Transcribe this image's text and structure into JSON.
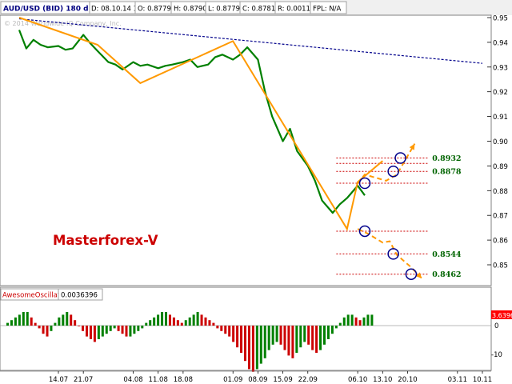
{
  "header": {
    "symbol": "AUD/USD (BID) 180 d 4h",
    "date": "D: 08.10.14 16:00",
    "open": "O: 0.8779",
    "high": "H: 0.8790",
    "low": "L: 0.8779",
    "close": "C: 0.8781",
    "range": "R: 0.0011",
    "fpl": "FPL: N/A",
    "copyright": "© 2014 Worldwide-IQ Company, Inc."
  },
  "brand_label": "Masterforex-V",
  "oscillator": {
    "name": "AwesomeOscillator",
    "value": "0.0036396",
    "current_tag": "3.6396",
    "y_ticks": [
      "0",
      "-10"
    ]
  },
  "chart_data": [
    {
      "type": "line",
      "title": "AUD/USD (BID) 180 d 4h",
      "x_tick_labels": [
        "14.07",
        "21.07",
        "04.08",
        "11.08",
        "18.08",
        "01.09",
        "08.09",
        "15.09",
        "22.09",
        "06.10",
        "13.10",
        "20.10",
        "03.11",
        "10.11"
      ],
      "y_tick_labels": [
        "0.95",
        "0.94",
        "0.93",
        "0.92",
        "0.91",
        "0.90",
        "0.89",
        "0.88",
        "0.87",
        "0.86",
        "0.85"
      ],
      "ylim": [
        0.842,
        0.953
      ],
      "grid": false,
      "series": [
        {
          "x": [
            "03.07",
            "05.07",
            "07.07",
            "09.07",
            "11.07",
            "14.07",
            "16.07",
            "18.07",
            "21.07",
            "23.07",
            "25.07",
            "28.07",
            "30.07",
            "01.08",
            "04.08",
            "06.08",
            "08.08",
            "11.08",
            "13.08",
            "15.08",
            "18.08",
            "20.08",
            "22.08",
            "25.08",
            "27.08",
            "29.08",
            "01.09",
            "03.09",
            "05.09",
            "08.09",
            "10.09",
            "12.09",
            "15.09",
            "17.09",
            "19.09",
            "22.09",
            "24.09",
            "26.09",
            "29.09",
            "01.10",
            "03.10",
            "06.10",
            "08.10"
          ],
          "values": [
            0.945,
            0.9375,
            0.941,
            0.939,
            0.938,
            0.9385,
            0.937,
            0.9375,
            0.943,
            0.9395,
            0.9365,
            0.932,
            0.931,
            0.929,
            0.932,
            0.9305,
            0.931,
            0.9295,
            0.9305,
            0.931,
            0.932,
            0.933,
            0.93,
            0.931,
            0.934,
            0.935,
            0.933,
            0.935,
            0.938,
            0.933,
            0.92,
            0.91,
            0.9,
            0.905,
            0.896,
            0.89,
            0.884,
            0.876,
            0.871,
            0.8745,
            0.877,
            0.882,
            0.8781
          ]
        }
      ],
      "trend_line": {
        "from": [
          "03.07",
          0.9495
        ],
        "to": [
          "10.11",
          0.9315
        ]
      },
      "wave_path": [
        [
          "03.07",
          0.95
        ],
        [
          "25.07",
          0.939
        ],
        [
          "06.08",
          0.9235
        ],
        [
          "01.09",
          0.9405
        ],
        [
          "03.10",
          0.8645
        ],
        [
          "06.10",
          0.8835
        ],
        [
          "13.10",
          0.892
        ]
      ],
      "projection_path": [
        [
          "06.10",
          0.883
        ],
        [
          "08.10",
          0.8865
        ],
        [
          "14.10",
          0.884
        ],
        [
          "17.10",
          0.8865
        ],
        [
          "22.10",
          0.899
        ]
      ],
      "lower_projection_path": [
        [
          "06.10",
          0.8645
        ],
        [
          "09.10",
          0.8625
        ],
        [
          "13.10",
          0.859
        ],
        [
          "15.10",
          0.8595
        ],
        [
          "17.10",
          0.854
        ],
        [
          "21.10",
          0.849
        ],
        [
          "24.10",
          0.8445
        ]
      ],
      "levels": [
        {
          "value": 0.8932,
          "label": "0.8932"
        },
        {
          "value": 0.891,
          "label": ""
        },
        {
          "value": 0.8878,
          "label": "0.8878"
        },
        {
          "value": 0.883,
          "label": ""
        },
        {
          "value": 0.8636,
          "label": ""
        },
        {
          "value": 0.8544,
          "label": "0.8544"
        },
        {
          "value": 0.8462,
          "label": "0.8462"
        }
      ],
      "markers": [
        [
          "08.10",
          0.883
        ],
        [
          "16.10",
          0.8878
        ],
        [
          "18.10",
          0.8932
        ],
        [
          "08.10",
          0.8636
        ],
        [
          "16.10",
          0.8544
        ],
        [
          "21.10",
          0.8462
        ]
      ],
      "colors": {
        "price": "#008000",
        "trend": "#00008b",
        "wave": "#ff9900",
        "level": "#cc0000",
        "marker": "#00008b",
        "label": "#006400"
      }
    },
    {
      "type": "bar",
      "title": "AwesomeOscillator",
      "y_tick_labels": [
        "0",
        "-10"
      ],
      "ylim": [
        -18,
        6
      ],
      "values": [
        1,
        2,
        3,
        4,
        5,
        5,
        3,
        1,
        -1,
        -3,
        -4,
        -2,
        1,
        3,
        4,
        5,
        4,
        2,
        0,
        -2,
        -4,
        -5,
        -6,
        -5,
        -4,
        -3,
        -2,
        -1,
        -2,
        -3,
        -4,
        -4,
        -3,
        -2,
        -1,
        1,
        2,
        3,
        4,
        5,
        5,
        4,
        3,
        2,
        1,
        2,
        3,
        4,
        5,
        4,
        3,
        2,
        1,
        -1,
        -2,
        -3,
        -4,
        -6,
        -8,
        -10,
        -13,
        -16,
        -17,
        -16,
        -14,
        -12,
        -9,
        -7,
        -6,
        -7,
        -9,
        -11,
        -12,
        -10,
        -8,
        -6,
        -7,
        -9,
        -10,
        -9,
        -7,
        -5,
        -3,
        -1,
        1,
        3,
        4,
        4,
        3,
        2,
        3,
        4,
        4
      ],
      "colors": {
        "up": "#008000",
        "down": "#cc0000",
        "tag": "#ff0000"
      }
    }
  ]
}
